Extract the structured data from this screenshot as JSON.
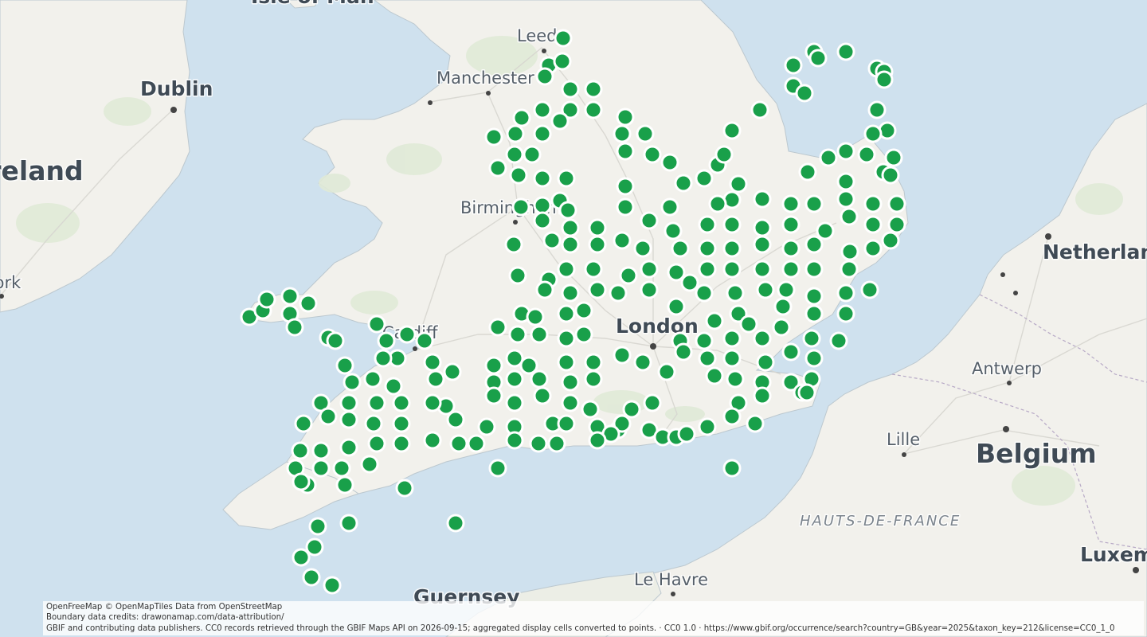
{
  "map": {
    "places": [
      {
        "name": "Isle of Man",
        "kind": "region-bold"
      },
      {
        "name": "Leeds",
        "kind": "city"
      },
      {
        "name": "Manchester",
        "kind": "city"
      },
      {
        "name": "Dublin",
        "kind": "capital"
      },
      {
        "name": "Ireland",
        "kind": "country"
      },
      {
        "name": "Birmingham",
        "kind": "city"
      },
      {
        "name": "Cork",
        "kind": "city"
      },
      {
        "name": "Cardiff",
        "kind": "city"
      },
      {
        "name": "London",
        "kind": "capital"
      },
      {
        "name": "Antwerp",
        "kind": "city"
      },
      {
        "name": "Netherlands",
        "kind": "country"
      },
      {
        "name": "Lille",
        "kind": "city"
      },
      {
        "name": "Belgium",
        "kind": "country"
      },
      {
        "name": "HAUTS-DE-FRANCE",
        "kind": "region"
      },
      {
        "name": "Le Havre",
        "kind": "city"
      },
      {
        "name": "Guernsey",
        "kind": "island"
      },
      {
        "name": "Luxembourg",
        "kind": "country"
      }
    ],
    "marker_color": "#19a04a",
    "sea_color": "#cfe1ee",
    "land_color": "#f2f1ec"
  },
  "attribution": {
    "line1": "OpenFreeMap © OpenMapTiles Data from OpenStreetMap",
    "line2": "Boundary data credits: drawonamap.com/data-attribution/",
    "line3": "GBIF and contributing data publishers. CC0 records retrieved through the GBIF Maps API on 2026-09-15; aggregated display cells converted to points. · CC0 1.0 · https://www.gbif.org/occurrence/search?country=GB&year=2025&taxon_key=212&license=CC0_1_0"
  }
}
